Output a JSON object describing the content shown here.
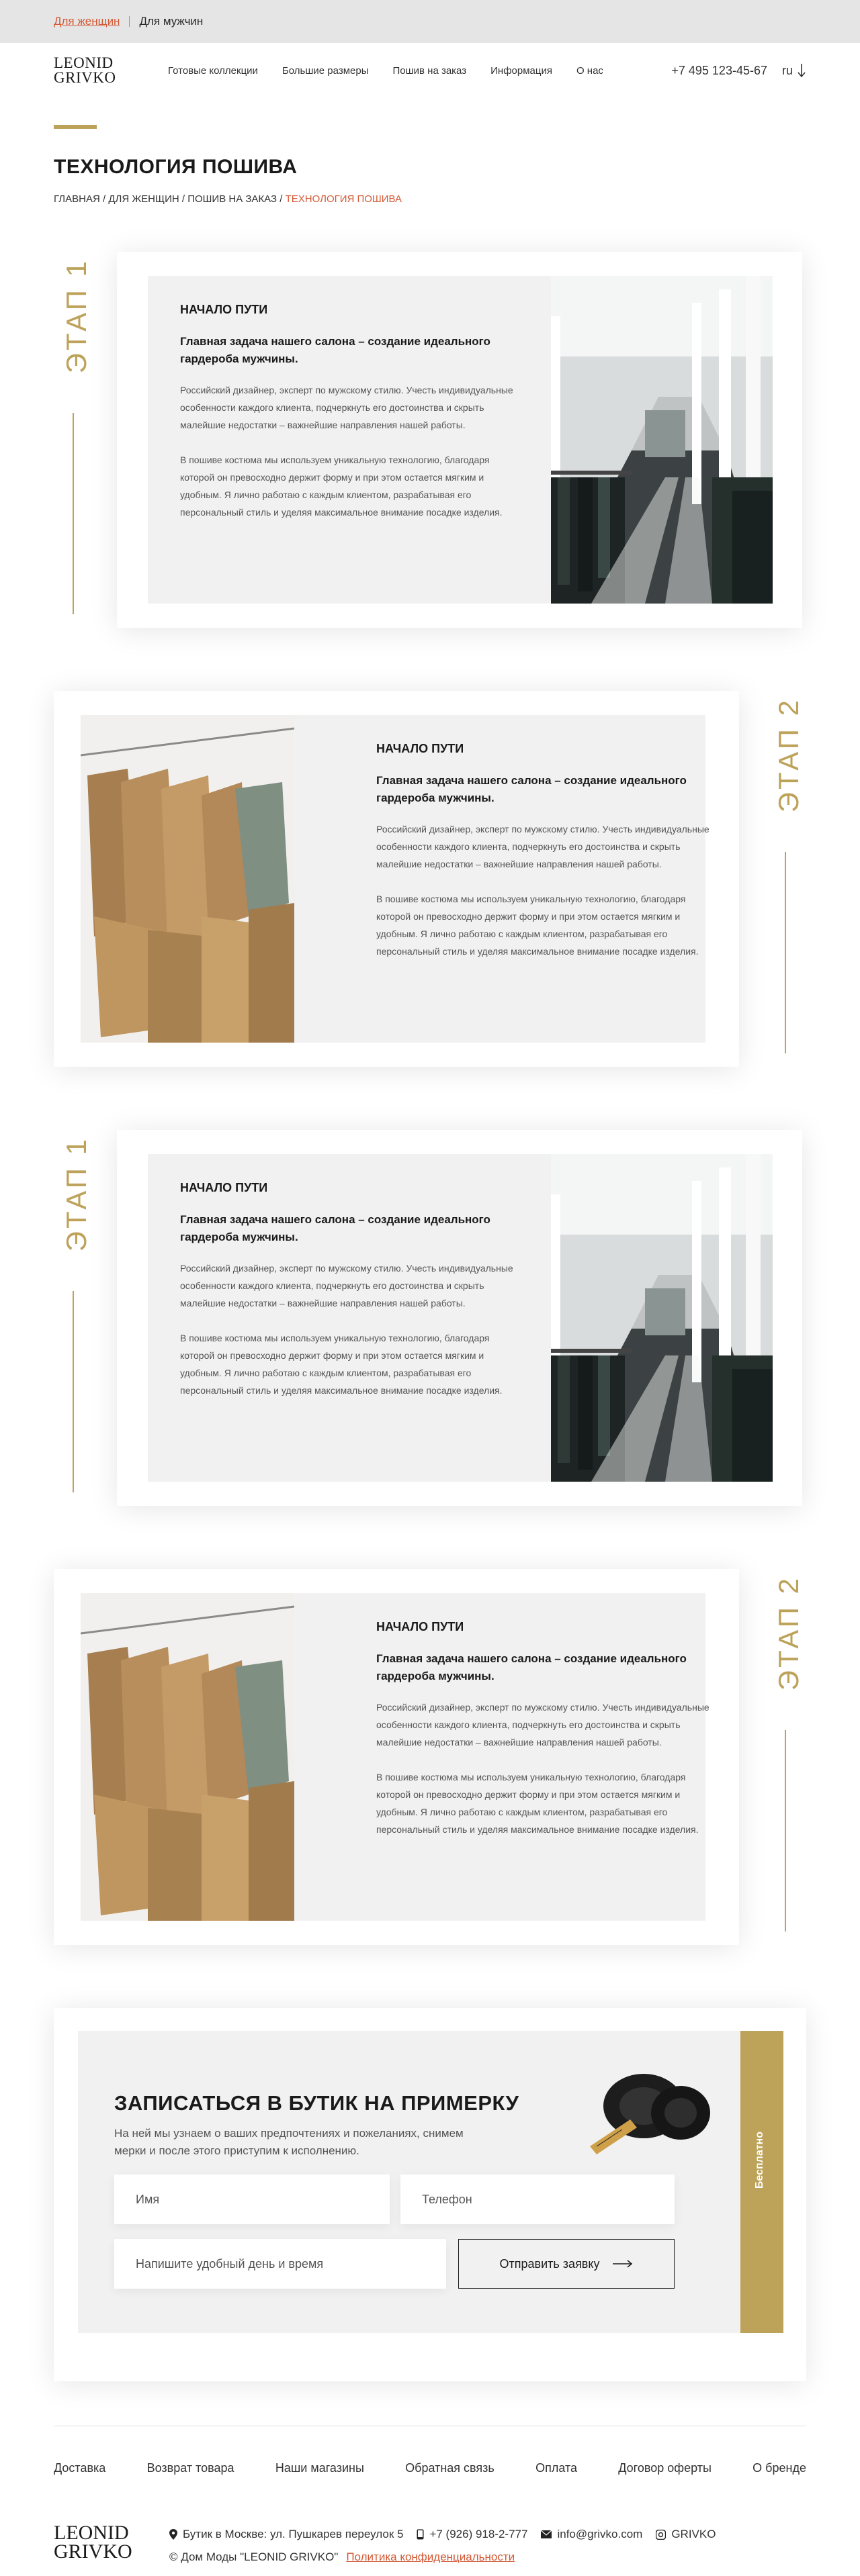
{
  "topbar": {
    "women": "Для женщин",
    "men": "Для мужчин"
  },
  "header": {
    "logo_line1": "LEONID",
    "logo_line2": "GRIVKO",
    "nav": [
      "Готовые коллекции",
      "Большие размеры",
      "Пошив на заказ",
      "Информация",
      "О нас"
    ],
    "phone": "+7 495 123-45-67",
    "lang": "ru"
  },
  "page": {
    "title": "ТЕХНОЛОГИЯ ПОШИВА",
    "breadcrumbs": {
      "home": "ГЛАВНАЯ",
      "women": "ДЛЯ ЖЕНЩИН",
      "custom": "ПОШИВ НА ЗАКАЗ",
      "current": "ТЕХНОЛОГИЯ ПОШИВА",
      "sep": " / "
    }
  },
  "stages": [
    {
      "label": "ЭТАП 1",
      "heading": "НАЧАЛО ПУТИ",
      "lead": "Главная задача нашего салона – создание идеального гардероба мужчины.",
      "p1": "Российский дизайнер, эксперт по мужскому стилю. Учесть индивидуальные особенности каждого клиента, подчеркнуть его достоинства и скрыть малейшие недостатки – важнейшие направления нашей работы.",
      "p2": "В пошиве костюма мы используем уникальную технологию, благодаря которой он превосходно держит форму и при этом остается мягким и удобным. Я лично работаю с каждым клиентом, разрабатывая его персональный стиль и уделяя максимальное внимание посадке изделия."
    },
    {
      "label": "ЭТАП 2",
      "heading": "НАЧАЛО ПУТИ",
      "lead": "Главная задача нашего салона – создание идеального гардероба мужчины.",
      "p1": "Российский дизайнер, эксперт по мужскому стилю. Учесть индивидуальные особенности каждого клиента, подчеркнуть его достоинства и скрыть малейшие недостатки – важнейшие направления нашей работы.",
      "p2": "В пошиве костюма мы используем уникальную технологию, благодаря которой он превосходно держит форму и при этом остается мягким и удобным. Я лично работаю с каждым клиентом, разрабатывая его персональный стиль и уделяя максимальное внимание посадке изделия."
    },
    {
      "label": "ЭТАП 1",
      "heading": "НАЧАЛО ПУТИ",
      "lead": "Главная задача нашего салона – создание идеального гардероба мужчины.",
      "p1": "Российский дизайнер, эксперт по мужскому стилю. Учесть индивидуальные особенности каждого клиента, подчеркнуть его достоинства и скрыть малейшие недостатки – важнейшие направления нашей работы.",
      "p2": "В пошиве костюма мы используем уникальную технологию, благодаря которой он превосходно держит форму и при этом остается мягким и удобным. Я лично работаю с каждым клиентом, разрабатывая его персональный стиль и уделяя максимальное внимание посадке изделия."
    },
    {
      "label": "ЭТАП 2",
      "heading": "НАЧАЛО ПУТИ",
      "lead": "Главная задача нашего салона – создание идеального гардероба мужчины.",
      "p1": "Российский дизайнер, эксперт по мужскому стилю. Учесть индивидуальные особенности каждого клиента, подчеркнуть его достоинства и скрыть малейшие недостатки – важнейшие направления нашей работы.",
      "p2": "В пошиве костюма мы используем уникальную технологию, благодаря которой он превосходно держит форму и при этом остается мягким и удобным. Я лично работаю с каждым клиентом, разрабатывая его персональный стиль и уделяя максимальное внимание посадке изделия."
    }
  ],
  "booking": {
    "title": "ЗАПИСАТЬСЯ В БУТИК НА ПРИМЕРКУ",
    "subtitle": "На ней мы узнаем о ваших предпочтениях и пожеланиях, снимем мерки и после этого приступим к исполнению.",
    "name_placeholder": "Имя",
    "phone_placeholder": "Телефон",
    "date_placeholder": "Напишите удобный день и время",
    "submit": "Отправить заявку",
    "badge": "Бесплатно"
  },
  "footer": {
    "links": [
      "Доставка",
      "Возврат товара",
      "Наши магазины",
      "Обратная связь",
      "Оплата",
      "Договор оферты",
      "О бренде"
    ],
    "logo_line1": "LEONID",
    "logo_line2": "GRIVKO",
    "address": "Бутик в Москве: ул. Пушкарев переулок 5",
    "phone": "+7 (926) 918-2-777",
    "email": "info@grivko.com",
    "social": "GRIVKO",
    "copyright": "© Дом Моды \"LEONID GRIVKO\"",
    "policy": "Политика конфиденциальности"
  },
  "colors": {
    "accent": "#d35a36",
    "gold": "#bda25a",
    "panel": "#f1f1f1"
  }
}
